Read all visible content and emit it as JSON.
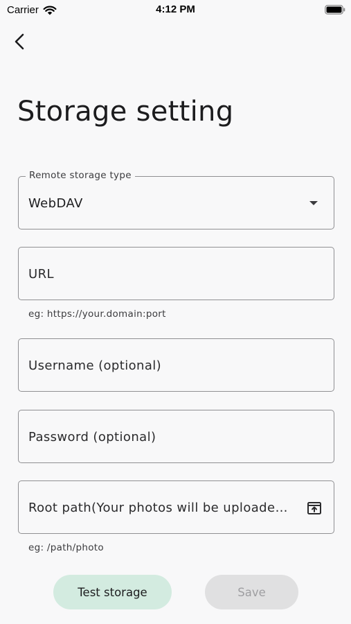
{
  "status_bar": {
    "carrier": "Carrier",
    "time": "4:12 PM"
  },
  "header": {
    "back_icon": "chevron-left-icon",
    "title": "Storage setting"
  },
  "form": {
    "storage_type": {
      "legend": "Remote storage type",
      "value": "WebDAV",
      "icon": "dropdown-arrow-icon"
    },
    "url": {
      "placeholder": "URL",
      "helper": "eg: https://your.domain:port"
    },
    "username": {
      "placeholder": "Username (optional)"
    },
    "password": {
      "placeholder": "Password (optional)"
    },
    "root_path": {
      "placeholder": "Root path(Your photos will be uploaded here)",
      "helper": "eg: /path/photo",
      "icon": "folder-upload-icon"
    }
  },
  "actions": {
    "test_label": "Test storage",
    "save_label": "Save"
  },
  "colors": {
    "background": "#f8f8f9",
    "test_button_bg": "#d3ebe0",
    "save_button_bg_disabled": "#e0e0e1",
    "border": "#8f8f92"
  }
}
